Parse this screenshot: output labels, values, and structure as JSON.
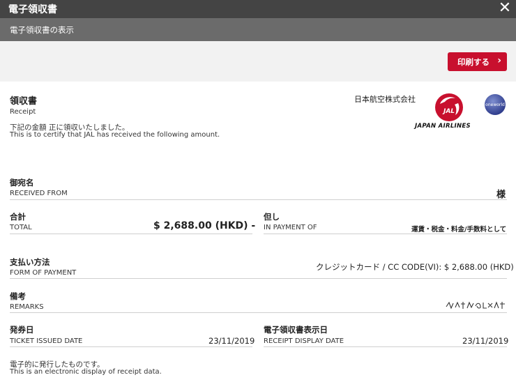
{
  "window": {
    "title": "電子領収書",
    "subtitle": "電子領収書の表示",
    "close_icon": "close-icon"
  },
  "toolbar": {
    "print_label": "印刷する",
    "print_icon": "chevron-right-icon"
  },
  "header": {
    "title_jp": "領収書",
    "title_en": "Receipt",
    "company": "日本航空株式会社",
    "cert_jp": "下記の金額 正に領収いたしました。",
    "cert_en": "This is to certify that JAL has received the following amount.",
    "logo_text": "JAL",
    "airline_name": "JAPAN AIRLINES",
    "alliance": "oneworld"
  },
  "received_from": {
    "label_jp": "御宛名",
    "label_en": "RECEIVED FROM",
    "suffix": "様"
  },
  "total": {
    "label_jp": "合計",
    "label_en": "TOTAL",
    "value": "$ 2,688.00 (HKD) -"
  },
  "payment_for": {
    "label_jp": "但し",
    "label_en": "IN PAYMENT OF",
    "value": "運賃・税金・料金/手数料として"
  },
  "form_of_payment": {
    "label_jp": "支払い方法",
    "label_en": "FORM OF PAYMENT",
    "value": "クレジットカード / CC CODE(VI): $ 2,688.00 (HKD)"
  },
  "remarks": {
    "label_jp": "備考",
    "label_en": "REMARKS"
  },
  "ticket_issued": {
    "label_jp": "発券日",
    "label_en": "TICKET ISSUED DATE",
    "value": "23/11/2019"
  },
  "receipt_display": {
    "label_jp": "電子領収書表示日",
    "label_en": "RECEIPT DISPLAY DATE",
    "value": "23/11/2019"
  },
  "footer": {
    "note_jp": "電子的に発行したものです。",
    "note_en": "This is an electronic display of receipt data."
  },
  "colors": {
    "jal_red": "#c8102e",
    "titlebar": "#444444",
    "subbar": "#6b6b6b",
    "oneworld_blue": "#3a4a9a"
  }
}
